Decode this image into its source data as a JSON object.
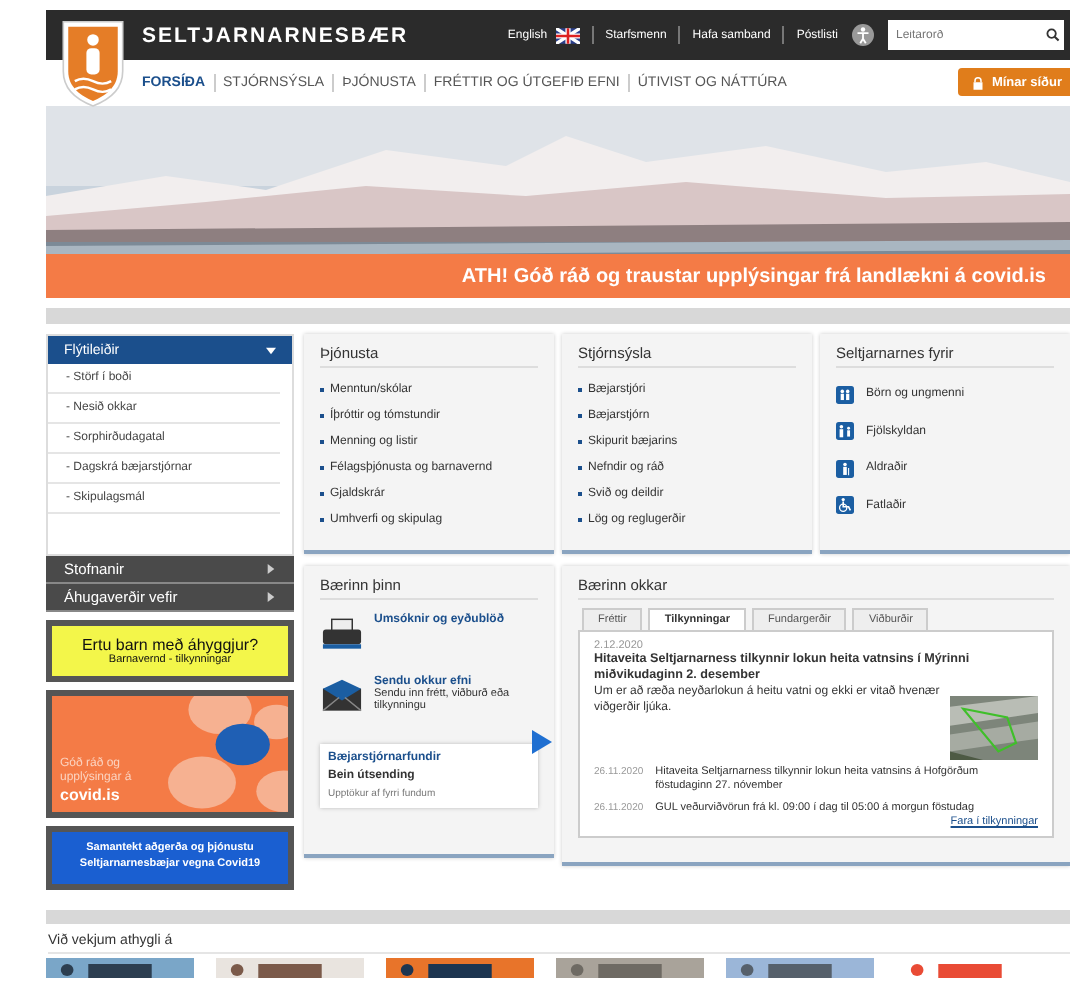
{
  "header": {
    "site_name": "SELTJARNARNESBÆR",
    "top_links": [
      "English",
      "Starfsmenn",
      "Hafa samband",
      "Póstlisti"
    ],
    "search": {
      "placeholder": "Leitarorð"
    },
    "nav": [
      {
        "label": "FORSÍÐA",
        "selected": true
      },
      {
        "label": "STJÓRNSÝSLA",
        "selected": false
      },
      {
        "label": "ÞJÓNUSTA",
        "selected": false
      },
      {
        "label": "FRÉTTIR OG ÚTGEFIÐ EFNI",
        "selected": false
      },
      {
        "label": "ÚTIVIST OG NÁTTÚRA",
        "selected": false
      }
    ],
    "my_pages": "Mínar síður"
  },
  "banner": {
    "kind": "picture",
    "notice": "ATH! Góð ráð og traustar upplýsingar frá landlækni á covid.is"
  },
  "sidebar": {
    "quick_links": {
      "title": "Flýtileiðir",
      "expanded": true,
      "items": [
        "- Störf í boði",
        "- Nesið okkar",
        "- Sorphirðudagatal",
        "- Dagskrá bæjarstjórnar",
        "- Skipulagsmál"
      ]
    },
    "sections": [
      {
        "label": "Stofnanir",
        "expanded": false
      },
      {
        "label": "Áhugaverðir vefir",
        "expanded": false
      }
    ],
    "promos": [
      {
        "kind": "yellow",
        "title": "Ertu barn með áhyggjur?",
        "subtitle": "Barnavernd - tilkynningar"
      },
      {
        "kind": "covid",
        "title": "Góð ráð og upplýsingar á",
        "subtitle": "covid.is"
      },
      {
        "kind": "blue",
        "title": "Samantekt aðgerða og þjónustu Seltjarnarnesbæjar vegna Covid19"
      }
    ]
  },
  "panels": [
    {
      "title": "Þjónusta",
      "items": [
        "Menntun/skólar",
        "Íþróttir og tómstundir",
        "Menning og listir",
        "Félagsþjónusta og barnavernd",
        "Gjaldskrár",
        "Umhverfi og skipulag"
      ]
    },
    {
      "title": "Stjórnsýsla",
      "items": [
        "Bæjarstjóri",
        "Bæjarstjórn",
        "Skipurit bæjarins",
        "Nefndir og ráð",
        "Svið og deildir",
        "Lög og reglugerðir"
      ]
    },
    {
      "title": "Seltjarnarnes fyrir",
      "items": [
        {
          "kind": "children",
          "label": "Börn og ungmenni"
        },
        {
          "kind": "family",
          "label": "Fjölskyldan"
        },
        {
          "kind": "elderly",
          "label": "Aldraðir"
        },
        {
          "kind": "wheelchair",
          "label": "Fatlaðir"
        }
      ]
    }
  ],
  "town": {
    "title": "Bærinn þinn",
    "links": [
      {
        "kind": "form",
        "title": "Umsóknir og eyðublöð"
      },
      {
        "kind": "submit",
        "title": "Sendu okkur efni",
        "text": "Sendu inn frétt, viðburð eða tilkynningu"
      }
    ],
    "meetings": {
      "title": "Bæjarstjórnarfundir",
      "subtitle": "Bein útsending",
      "text": "Upptökur af fyrri fundum"
    }
  },
  "our_town": {
    "title": "Bærinn okkar",
    "tabs": [
      {
        "label": "Fréttir",
        "selected": false
      },
      {
        "label": "Tilkynningar",
        "selected": true
      },
      {
        "label": "Fundargerðir",
        "selected": false
      },
      {
        "label": "Viðburðir",
        "selected": false
      }
    ],
    "featured": {
      "date": "2.12.2020",
      "title": "Hitaveita Seltjarnarness tilkynnir lokun heita vatnsins í Mýrinni miðvikudaginn 2. desember",
      "text": "Um er að ræða neyðarlokun á heitu vatni og ekki er vitað hvenær viðgerðir ljúka."
    },
    "items": [
      {
        "date": "26.11.2020",
        "text": "Hitaveita Seltjarnarness tilkynnir lokun heita vatnsins á Hofgörðum föstudaginn 27. nóvember"
      },
      {
        "date": "26.11.2020",
        "text": "GUL veðurviðvörun frá kl. 09:00 í dag til 05:00 á morgun föstudag"
      }
    ],
    "more_link": "Fara í tilkynningar"
  },
  "attention": {
    "title": "Við vekjum athygli á",
    "pictures": [
      {
        "kind": "sky"
      },
      {
        "kind": "people"
      },
      {
        "kind": "poster"
      },
      {
        "kind": "street"
      },
      {
        "kind": "building"
      },
      {
        "kind": "flowers"
      }
    ]
  }
}
